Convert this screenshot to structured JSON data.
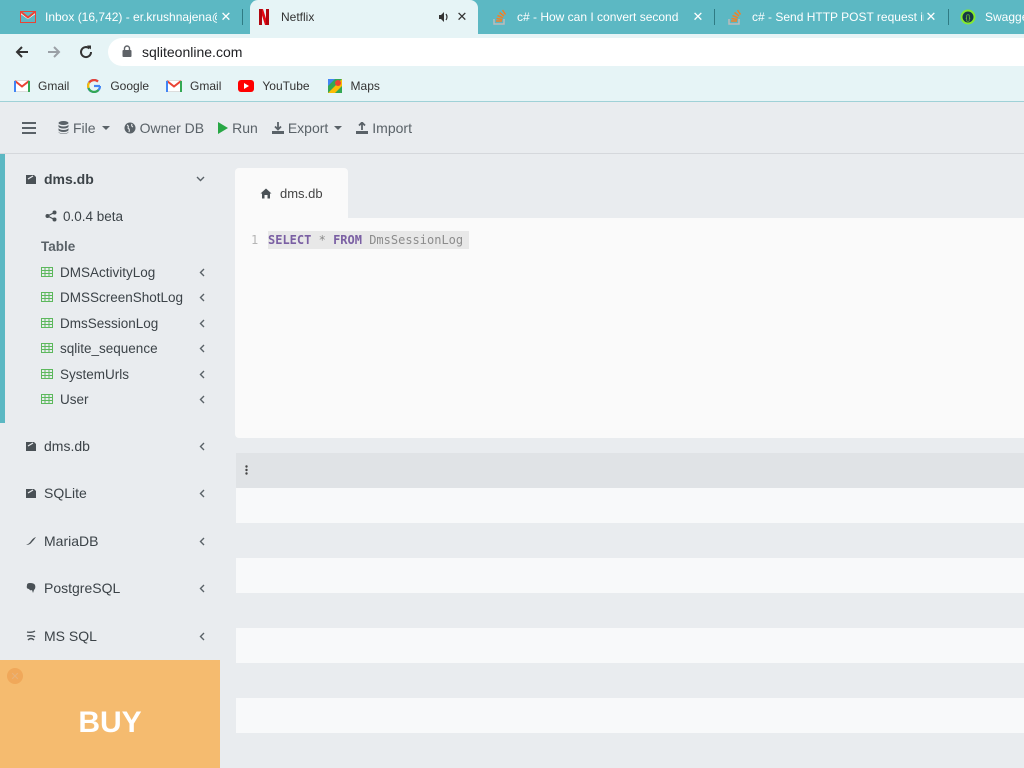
{
  "browser": {
    "tabs": [
      {
        "title": "Inbox (16,742) - er.krushnajena@",
        "favicon": "gmail-icon",
        "active": false
      },
      {
        "title": "Netflix",
        "favicon": "netflix-icon",
        "active": true,
        "audio": true
      },
      {
        "title": "c# - How can I convert seconds",
        "favicon": "stackoverflow-icon",
        "active": false
      },
      {
        "title": "c# - Send HTTP POST request in",
        "favicon": "stackoverflow-icon",
        "active": false
      },
      {
        "title": "Swagge",
        "favicon": "swagger-icon",
        "active": false
      }
    ],
    "url": "sqliteonline.com",
    "bookmarks": [
      {
        "label": "Gmail",
        "icon": "gmail-icon"
      },
      {
        "label": "Google",
        "icon": "google-icon"
      },
      {
        "label": "Gmail",
        "icon": "gmail-icon"
      },
      {
        "label": "YouTube",
        "icon": "youtube-icon"
      },
      {
        "label": "Maps",
        "icon": "maps-icon"
      }
    ]
  },
  "header": {
    "file_label": "File",
    "owner_db_label": "Owner DB",
    "run_label": "Run",
    "export_label": "Export",
    "import_label": "Import"
  },
  "sidebar": {
    "active_db": {
      "name": "dms.db",
      "version": "0.0.4 beta",
      "table_heading": "Table",
      "tables": [
        "DMSActivityLog",
        "DMSScreenShotLog",
        "DmsSessionLog",
        "sqlite_sequence",
        "SystemUrls",
        "User"
      ]
    },
    "databases": [
      "dms.db",
      "SQLite",
      "MariaDB",
      "PostgreSQL",
      "MS SQL"
    ],
    "buy_label": "BUY"
  },
  "editor": {
    "tab_label": "dms.db",
    "line_number": "1",
    "kw_select": "SELECT",
    "star": "*",
    "kw_from": "FROM",
    "table": "DmsSessionLog"
  },
  "results": {
    "menu_icon": "vertical-dots-icon"
  },
  "colors": {
    "tab_strip": "#5cb8c3",
    "accent": "#5cb8c3",
    "run_green": "#28a745",
    "buy_orange": "#f5bb6f"
  }
}
